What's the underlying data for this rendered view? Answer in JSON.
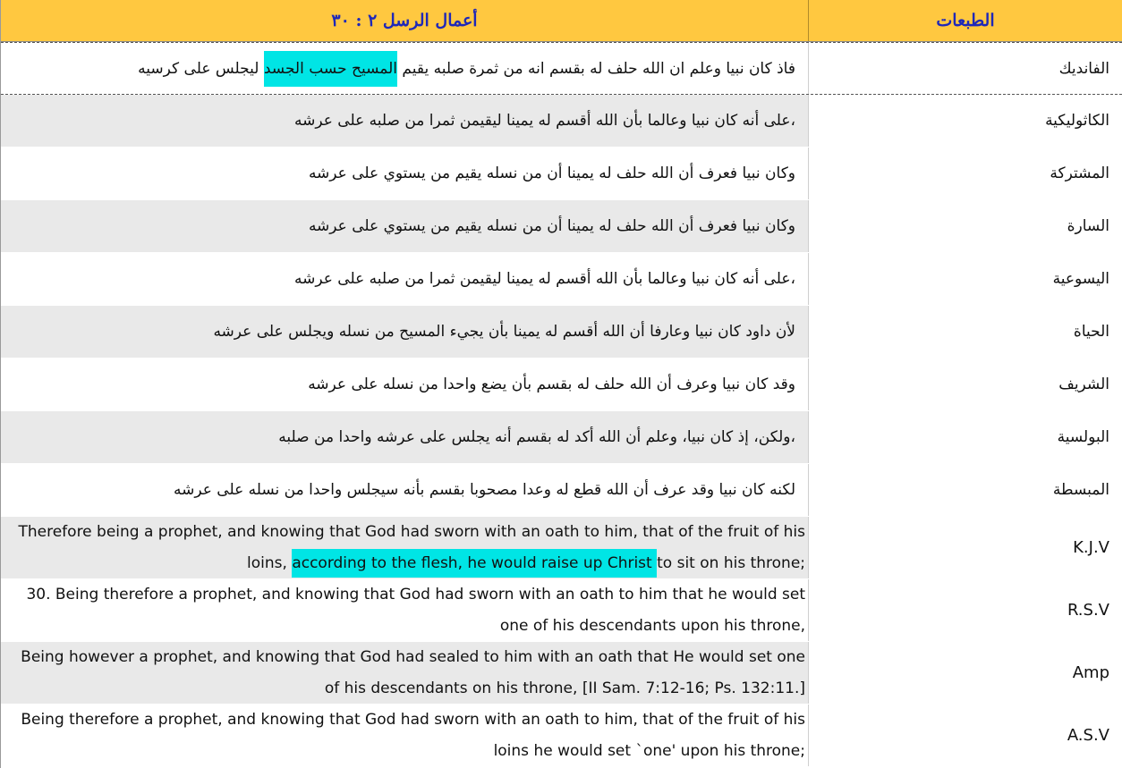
{
  "header": {
    "text_title": "أعمال الرسل ٢ : ٣٠",
    "editions_title": "الطبعات"
  },
  "rows": [
    {
      "edition": "الفانديك",
      "before": "فاذ كان نبيا وعلم ان الله حلف له بقسم انه من ثمرة صلبه يقيم ",
      "highlight": "المسيح حسب الجسد",
      "after": " ليجلس على كرسيه"
    },
    {
      "edition": "الكاثوليكية",
      "text": "،على أنه كان نبيا وعالما بأن الله أقسم له يمينا ليقيمن ثمرا من صلبه على عرشه"
    },
    {
      "edition": "المشتركة",
      "text": "وكان نبيا  فعرف أن الله حلف له يمينا أن من نسله يقيم من يستوي على عرشه"
    },
    {
      "edition": "السارة",
      "text": "وكان نبيا  فعرف أن الله حلف له يمينا أن من نسله يقيم من يستوي على عرشه"
    },
    {
      "edition": "اليسوعية",
      "text": "،على أنه كان نبيا وعالما بأن الله أقسم له يمينا ليقيمن ثمرا من صلبه على عرشه"
    },
    {
      "edition": "الحياة",
      "text": "لأن داود كان نبيا  وعارفا أن الله أقسم له يمينا بأن يجيء المسيح من نسله ويجلس على عرشه"
    },
    {
      "edition": "الشريف",
      "text": "وقد كان نبيا  وعرف أن الله حلف له بقسم بأن يضع واحدا من نسله على عرشه"
    },
    {
      "edition": "البولسية",
      "text": "،ولكن، إذ كان نبيا، وعلم أن الله أكد له بقسم أنه يجلس على عرشه واحدا من صلبه"
    },
    {
      "edition": "المبسطة",
      "text": "لكنه كان نبيا  وقد عرف أن الله قطع له وعدا مصحوبا بقسم بأنه سيجلس واحدا من نسله على عرشه"
    },
    {
      "edition": "K.J.V",
      "before": "Therefore being a prophet, and knowing that God had sworn with an oath to him, that of the fruit of his loins, ",
      "highlight": "according to the flesh, he would raise up Christ ",
      "after": "to sit on his throne;"
    },
    {
      "edition": "R.S.V",
      "text": "30. Being therefore a prophet, and knowing that God had sworn with an oath to him that he would set one of his descendants upon his throne,"
    },
    {
      "edition": "Amp",
      "text": "Being however a prophet, and knowing that God had sealed to him with an oath that He would set one of his descendants on his throne, [II Sam. 7:12-16; Ps. 132:11.]"
    },
    {
      "edition": "A.S.V",
      "text": "Being therefore a prophet, and knowing that God had sworn with an oath to him, that of the fruit of his loins he would set `one' upon his throne;"
    }
  ]
}
